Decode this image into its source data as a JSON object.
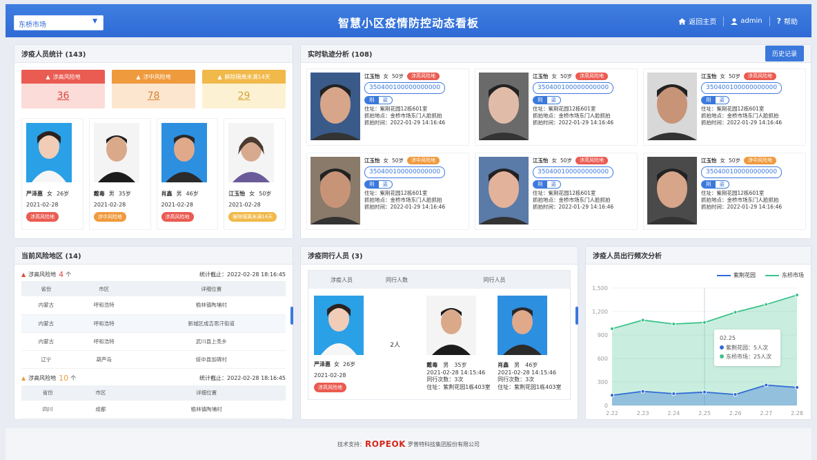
{
  "header": {
    "city_select": "东桥市场",
    "title": "智慧小区疫情防控动态看板",
    "home_link": "返回主页",
    "user": "admin",
    "help": "帮助",
    "colors": {
      "primary": "#2f6ad6"
    }
  },
  "involved": {
    "title": "涉疫人员统计 (143)",
    "stats": [
      {
        "label": "涉高风险地",
        "value": "36"
      },
      {
        "label": "涉中风险地",
        "value": "78"
      },
      {
        "label": "解除隔离未满14天",
        "value": "29"
      }
    ],
    "people": [
      {
        "name": "严泽惠",
        "gender": "女",
        "age": "26岁",
        "date": "2021-02-28",
        "tag": "涉高风险地",
        "tag_type": "high"
      },
      {
        "name": "戴毒",
        "gender": "男",
        "age": "35岁",
        "date": "2021-02-28",
        "tag": "涉中风险地",
        "tag_type": "mid"
      },
      {
        "name": "肖鑫",
        "gender": "男",
        "age": "46岁",
        "date": "2021-02-28",
        "tag": "涉高风险地",
        "tag_type": "high"
      },
      {
        "name": "江玉怡",
        "gender": "女",
        "age": "50岁",
        "date": "2021-02-28",
        "tag": "解除隔离未满14天",
        "tag_type": "rel"
      }
    ]
  },
  "tracks": {
    "title": "实时轨迹分析 (108)",
    "history_button": "历史记录",
    "cards": [
      {
        "name": "江玉怡",
        "gender": "女",
        "age": "50岁",
        "tag": "涉高风险地",
        "tag_type": "high",
        "id": "350400100000000000",
        "crime1": "刑",
        "crime2": "盗",
        "address": "住址：紫荆花园12栋601室",
        "capture_place": "抓拍地点：金桥市场东门人脸抓拍",
        "capture_time": "抓拍时间：2022-01-29  14:16:46"
      },
      {
        "name": "江玉怡",
        "gender": "女",
        "age": "50岁",
        "tag": "涉高风险地",
        "tag_type": "high",
        "id": "350400100000000000",
        "crime1": "刑",
        "crime2": "盗",
        "address": "住址：紫荆花园12栋601室",
        "capture_place": "抓拍地点：金桥市场东门人脸抓拍",
        "capture_time": "抓拍时间：2022-01-29  14:16:46"
      },
      {
        "name": "江玉怡",
        "gender": "女",
        "age": "50岁",
        "tag": "涉高风险地",
        "tag_type": "high",
        "id": "350400100000000000",
        "crime1": "刑",
        "crime2": "盗",
        "address": "住址：紫荆花园12栋601室",
        "capture_place": "抓拍地点：金桥市场东门人脸抓拍",
        "capture_time": "抓拍时间：2022-01-29  14:16:46"
      },
      {
        "name": "江玉怡",
        "gender": "女",
        "age": "50岁",
        "tag": "涉中风险地",
        "tag_type": "mid",
        "id": "350400100000000000",
        "crime1": "刑",
        "crime2": "盗",
        "address": "住址：紫荆花园12栋601室",
        "capture_place": "抓拍地点：金桥市场东门人脸抓拍",
        "capture_time": "抓拍时间：2022-01-29  14:16:46"
      },
      {
        "name": "江玉怡",
        "gender": "女",
        "age": "50岁",
        "tag": "涉高风险地",
        "tag_type": "high",
        "id": "350400100000000000",
        "crime1": "刑",
        "crime2": "盗",
        "address": "住址：紫荆花园12栋601室",
        "capture_place": "抓拍地点：金桥市场东门人脸抓拍",
        "capture_time": "抓拍时间：2022-01-29  14:16:46"
      },
      {
        "name": "江玉怡",
        "gender": "女",
        "age": "50岁",
        "tag": "涉中风险地",
        "tag_type": "mid",
        "id": "350400100000000000",
        "crime1": "刑",
        "crime2": "盗",
        "address": "住址：紫荆花园12栋601室",
        "capture_place": "抓拍地点：金桥市场东门人脸抓拍",
        "capture_time": "抓拍时间：2022-01-29  14:16:46"
      }
    ]
  },
  "risk_areas": {
    "title": "当前风险地区 (14)",
    "high": {
      "label": "涉高风险地",
      "count": "4",
      "unit": "个",
      "stat_time": "统计截止：2022-02-28  18:16:45"
    },
    "mid": {
      "label": "涉高风险地",
      "count": "10",
      "unit": "个",
      "stat_time": "统计截止：2022-02-28  18:16:45"
    },
    "columns": [
      "省份",
      "市区",
      "详细位置"
    ],
    "high_rows": [
      [
        "内蒙古",
        "呼和浩特",
        "榆林镇陶埔村"
      ],
      [
        "内蒙古",
        "呼和浩特",
        "新城区成吉思汗街道"
      ],
      [
        "内蒙古",
        "呼和浩特",
        "武川县上秃乡"
      ],
      [
        "辽宁",
        "葫芦岛",
        "绥中县加碑村"
      ]
    ],
    "mid_rows": [
      [
        "四川",
        "成都",
        "榆林镇陶埔村"
      ]
    ]
  },
  "companions": {
    "title": "涉疫同行人员 (3)",
    "columns": [
      "涉疫人员",
      "同行人数",
      "同行人员"
    ],
    "main": {
      "name": "严泽惠",
      "gender": "女",
      "age": "26岁",
      "date": "2021-02-28",
      "tag": "涉高风险地"
    },
    "count": "2人",
    "people": [
      {
        "name": "戴毒",
        "gender": "男",
        "age": "35岁",
        "datetime": "2021-02-28  14:15:46",
        "times": "同行次数：3次",
        "address": "住址：紫荆花园1栋403室"
      },
      {
        "name": "肖鑫",
        "gender": "男",
        "age": "46岁",
        "datetime": "2021-02-28  14:15:46",
        "times": "同行次数：3次",
        "address": "住址：紫荆花园1栋403室"
      }
    ]
  },
  "frequency": {
    "title": "涉疫人员出行频次分析",
    "tooltip": {
      "date": "02.25",
      "row1": "紫荆花园：5人次",
      "row2": "东桥市场：25人次"
    },
    "legend": [
      "紫荆花园",
      "东桥市场"
    ],
    "colors": {
      "blue": "#2f6ad6",
      "green": "#3cc28b"
    }
  },
  "chart_data": {
    "type": "area",
    "title": "涉疫人员出行频次分析",
    "categories": [
      "2.22",
      "2.23",
      "2.24",
      "2.25",
      "2.26",
      "2.27",
      "2.28"
    ],
    "ylim": [
      0,
      1500
    ],
    "yticks": [
      "1,500",
      "1,200",
      "900",
      "600",
      "300",
      "0"
    ],
    "series": [
      {
        "name": "紫荆花园",
        "values": [
          130,
          180,
          150,
          170,
          140,
          260,
          230
        ]
      },
      {
        "name": "东桥市场",
        "values": [
          980,
          1090,
          1040,
          1060,
          1190,
          1290,
          1410
        ]
      }
    ],
    "grid": true,
    "legend_position": "top-right"
  },
  "footer": {
    "prefix": "技术支持：",
    "brand": "ROPEOK",
    "company": "罗普特科技集团股份有限公司"
  }
}
